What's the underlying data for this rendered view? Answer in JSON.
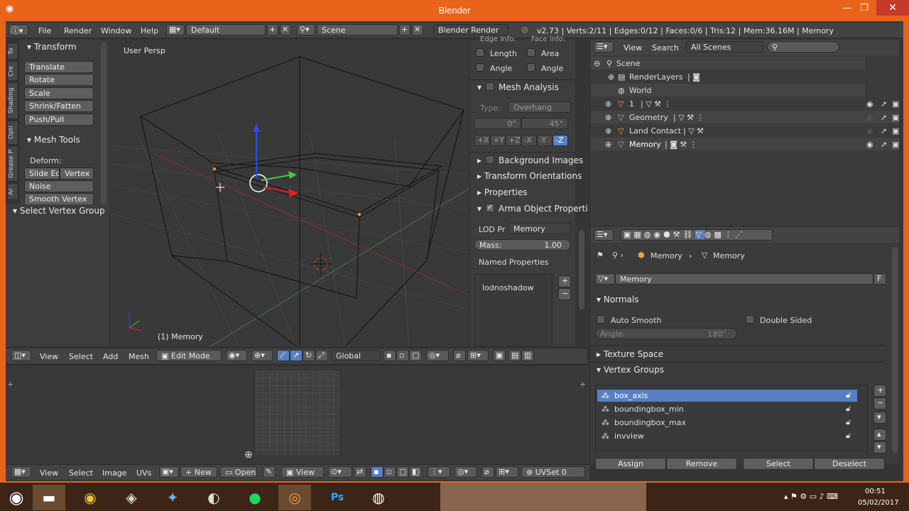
{
  "window": {
    "title": "Blender"
  },
  "menubar": {
    "file": "File",
    "render": "Render",
    "window": "Window",
    "help": "Help",
    "layout": "Default",
    "scene": "Scene",
    "engine": "Blender Render",
    "stats": "v2.73 | Verts:2/11 | Edges:0/12 | Faces:0/6 | Tris:12 | Mem:36.16M | Memory"
  },
  "tool_tabs": [
    "To",
    "Cre",
    "Shading",
    "Opti",
    "Grease P",
    "Ar"
  ],
  "toolshelf": {
    "transform_header": "Transform",
    "translate": "Translate",
    "rotate": "Rotate",
    "scale": "Scale",
    "shrink": "Shrink/Fatten",
    "pushpull": "Push/Pull",
    "meshtools_header": "Mesh Tools",
    "deform": "Deform:",
    "slide": "Slide Ed",
    "vertex": "Vertex",
    "noise": "Noise",
    "smooth": "Smooth Vertex",
    "svg": "Select Vertex Group"
  },
  "viewport": {
    "view_label": "User Persp",
    "object_label": "(1) Memory",
    "menu_view": "View",
    "menu_select": "Select",
    "menu_add": "Add",
    "menu_mesh": "Mesh",
    "mode": "Edit Mode",
    "orientation": "Global"
  },
  "npanel": {
    "edge_info": "Edge Info:",
    "face_info": "Face Info:",
    "length": "Length",
    "area": "Area",
    "angle1": "Angle",
    "angle2": "Angle",
    "mesh_analysis": "Mesh Analysis",
    "type_label": "Type:",
    "type_value": "Overhang",
    "deg0": "0°",
    "deg45": "45°",
    "axes": [
      "+X",
      "+Y",
      "+Z",
      "-X",
      "-Y",
      "-Z"
    ],
    "bg_images": "Background Images",
    "transform_orient": "Transform Orientations",
    "properties": "Properties",
    "arma_props": "Arma Object Properti",
    "lod_label": "LOD Pr",
    "lod_value": "Memory",
    "mass_label": "Mass:",
    "mass_value": "1.00",
    "named_props": "Named Properties",
    "named_item": "lodnoshadow"
  },
  "uv_editor": {
    "view": "View",
    "select": "Select",
    "image": "Image",
    "uvs": "UVs",
    "new": "New",
    "open": "Open",
    "view2": "View",
    "uvset": "UVSet 0"
  },
  "outliner": {
    "view": "View",
    "search": "Search",
    "filter": "All Scenes",
    "items": [
      {
        "label": "Scene"
      },
      {
        "label": "RenderLayers"
      },
      {
        "label": "World"
      },
      {
        "label": "1"
      },
      {
        "label": "Geometry"
      },
      {
        "label": "Land Contact"
      },
      {
        "label": "Memory"
      }
    ]
  },
  "properties": {
    "crumb1": "Memory",
    "crumb2": "Memory",
    "mesh_name": "Memory",
    "fake_user": "F",
    "normals": "Normals",
    "auto_smooth": "Auto Smooth",
    "double_sided": "Double Sided",
    "angle_label": "Angle:",
    "angle_value": "180°",
    "texture_space": "Texture Space",
    "vertex_groups": "Vertex Groups",
    "groups": [
      "box_axis",
      "boundingbox_min",
      "boundingbox_max",
      "invview"
    ],
    "assign": "Assign",
    "remove": "Remove",
    "select": "Select",
    "deselect": "Deselect"
  },
  "taskbar": {
    "time": "00:51",
    "date": "05/02/2017",
    "apps": [
      "chrome-icon",
      "gimp-icon",
      "netbeans-icon",
      "steam-icon",
      "spotify-icon",
      "blender-icon",
      "photoshop-icon",
      "obs-icon"
    ]
  }
}
